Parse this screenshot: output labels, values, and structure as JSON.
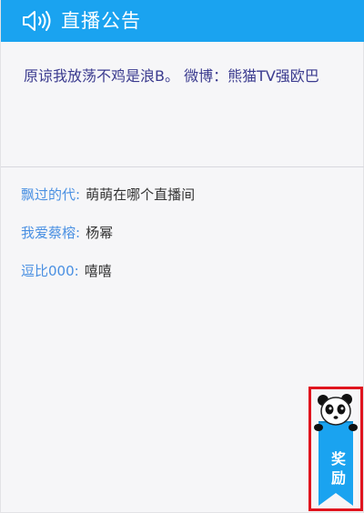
{
  "header": {
    "icon": "speaker-icon",
    "title": "直播公告"
  },
  "notice": {
    "text": "原谅我放荡不鸡是浪B。 微博：熊猫TV强欧巴"
  },
  "chat": {
    "messages": [
      {
        "user": "飘过的代:",
        "text": "萌萌在哪个直播间"
      },
      {
        "user": "我爱蔡榕:",
        "text": "杨幂"
      },
      {
        "user": "逗比000:",
        "text": "嘻嘻"
      }
    ]
  },
  "reward": {
    "icon": "panda-icon",
    "label": "奖励"
  },
  "colors": {
    "header_bg": "#1aa3f0",
    "username": "#4a90e2",
    "notice_text": "#3b3b8f",
    "reward_ribbon": "#1aa3f0",
    "highlight_border": "#e0141e"
  }
}
